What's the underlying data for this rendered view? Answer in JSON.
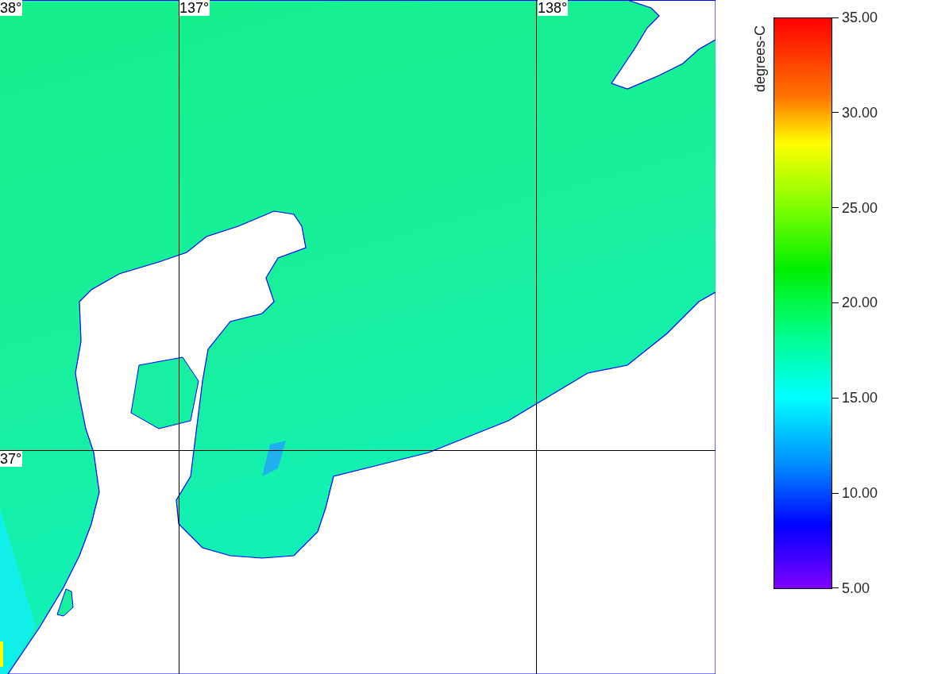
{
  "map": {
    "grid_labels": [
      {
        "kind": "latitude",
        "text": "38°"
      },
      {
        "kind": "longitude",
        "text": "137°"
      },
      {
        "kind": "longitude",
        "text": "138°"
      },
      {
        "kind": "latitude",
        "text": "37°"
      }
    ]
  },
  "legend": {
    "title": "degrees-C",
    "ticks": [
      "35.00",
      "30.00",
      "25.00",
      "20.00",
      "15.00",
      "10.00",
      "5.00"
    ]
  }
}
